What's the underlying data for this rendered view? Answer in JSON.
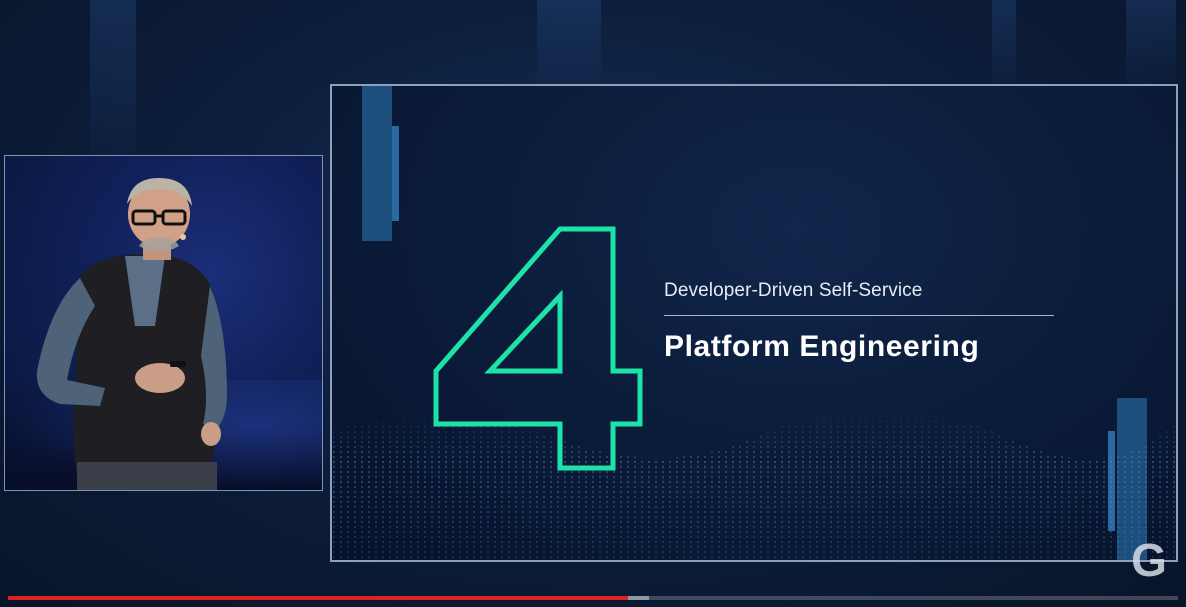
{
  "slide": {
    "number": "4",
    "subtitle": "Developer-Driven Self-Service",
    "title": "Platform Engineering"
  },
  "brand": {
    "logo_letter": "G",
    "icon": "brand-g-logo-icon"
  },
  "player": {
    "progress_fraction": 0.53,
    "buffered_fraction": 0.548,
    "progress_color": "#e32020"
  },
  "colors": {
    "accent_number": "#1ee3a8",
    "slide_bg": "#0b1c3a",
    "stage_bg": "#0d1f3d"
  }
}
